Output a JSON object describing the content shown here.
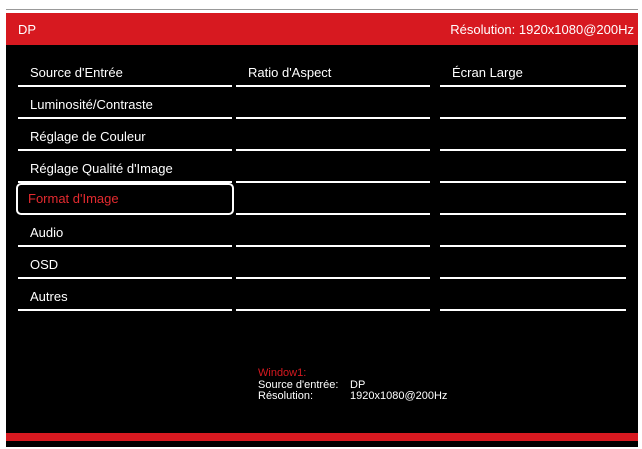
{
  "header": {
    "source": "DP",
    "resolution_text": "Résolution: 1920x1080@200Hz"
  },
  "menu": {
    "items": [
      {
        "label": "Source d'Entrée"
      },
      {
        "label": "Luminosité/Contraste"
      },
      {
        "label": "Réglage de Couleur"
      },
      {
        "label": "Réglage Qualité d'Image"
      },
      {
        "label": "Format d'Image",
        "selected": true
      },
      {
        "label": "Audio"
      },
      {
        "label": "OSD"
      },
      {
        "label": "Autres"
      }
    ]
  },
  "submenu": {
    "col1_first": "Ratio d'Aspect",
    "col2_first": "Écran Large"
  },
  "info": {
    "window_label": "Window1:",
    "source_label": "Source d'entrée:",
    "source_value": "DP",
    "resolution_label": "Résolution:",
    "resolution_value": "1920x1080@200Hz"
  },
  "colors": {
    "accent": "#d71920",
    "background": "#000000",
    "text": "#ffffff"
  }
}
